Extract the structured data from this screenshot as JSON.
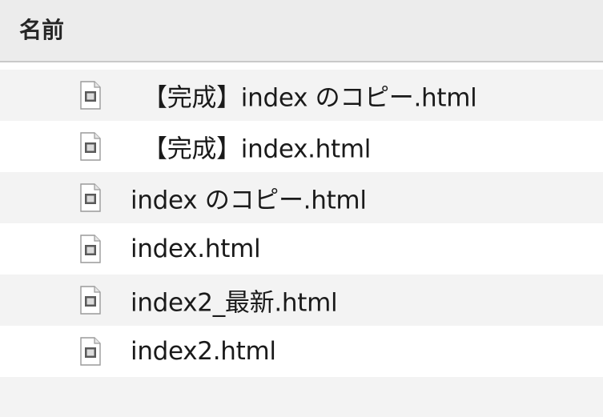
{
  "columns": {
    "name_header": "名前"
  },
  "files": [
    {
      "name": "【完成】index のコピー.html",
      "icon": "html-document-icon"
    },
    {
      "name": "【完成】index.html",
      "icon": "html-document-icon"
    },
    {
      "name": "index のコピー.html",
      "icon": "html-document-icon"
    },
    {
      "name": "index.html",
      "icon": "html-document-icon"
    },
    {
      "name": "index2_最新.html",
      "icon": "html-document-icon"
    },
    {
      "name": "index2.html",
      "icon": "html-document-icon"
    }
  ],
  "colors": {
    "header_bg": "#ececec",
    "stripe_bg": "#f3f3f3",
    "row_bg": "#ffffff"
  }
}
